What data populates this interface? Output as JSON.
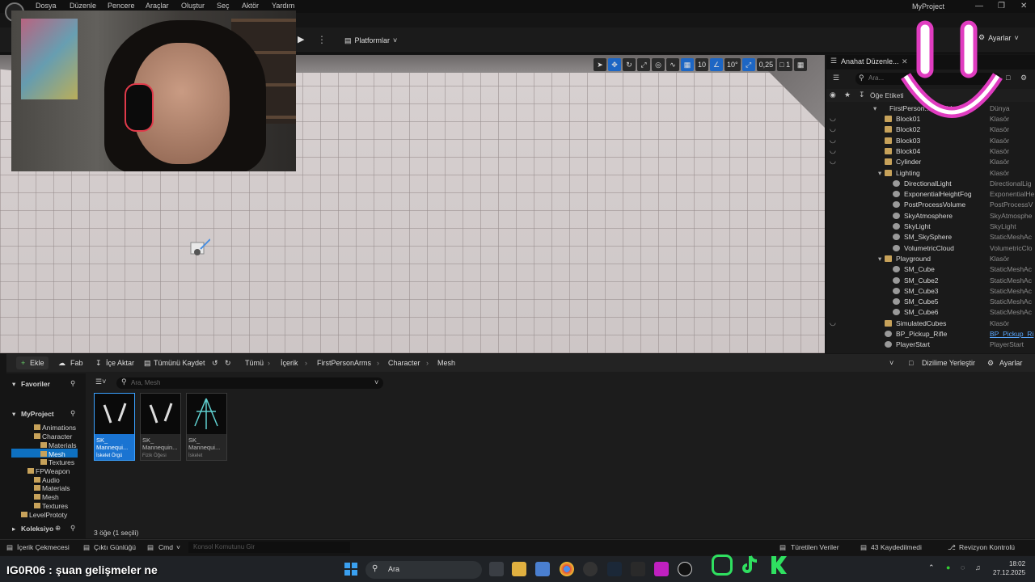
{
  "menu": {
    "items": [
      "Dosya",
      "Düzenle",
      "Pencere",
      "Araçlar",
      "Oluştur",
      "Seç",
      "Aktör",
      "Yardım"
    ]
  },
  "app": {
    "project": "MyProject"
  },
  "toolbar": {
    "platforms": "Platformlar",
    "settings": "Ayarlar"
  },
  "viewport_tools": {
    "grid": "10",
    "angle": "10°",
    "scale": "0,25",
    "cams": "1"
  },
  "outliner": {
    "title": "Anahat Düzenle...",
    "search_placeholder": "Ara...",
    "col_label": "Öğe Etiketi",
    "root": {
      "name": "FirstPerson...(Editör)",
      "type": "Dünya"
    },
    "rows": [
      {
        "name": "Block01",
        "type": "Klasör"
      },
      {
        "name": "Block02",
        "type": "Klasör"
      },
      {
        "name": "Block03",
        "type": "Klasör"
      },
      {
        "name": "Block04",
        "type": "Klasör"
      },
      {
        "name": "Cylinder",
        "type": "Klasör"
      },
      {
        "name": "Lighting",
        "type": "Klasör"
      },
      {
        "name": "DirectionalLight",
        "type": "DirectionalLig"
      },
      {
        "name": "ExponentialHeightFog",
        "type": "ExponentialHe"
      },
      {
        "name": "PostProcessVolume",
        "type": "PostProcessV"
      },
      {
        "name": "SkyAtmosphere",
        "type": "SkyAtmosphe"
      },
      {
        "name": "SkyLight",
        "type": "SkyLight"
      },
      {
        "name": "SM_SkySphere",
        "type": "StaticMeshAc"
      },
      {
        "name": "VolumetricCloud",
        "type": "VolumetricClo"
      },
      {
        "name": "Playground",
        "type": "Klasör"
      },
      {
        "name": "SM_Cube",
        "type": "StaticMeshAc"
      },
      {
        "name": "SM_Cube2",
        "type": "StaticMeshAc"
      },
      {
        "name": "SM_Cube3",
        "type": "StaticMeshAc"
      },
      {
        "name": "SM_Cube5",
        "type": "StaticMeshAc"
      },
      {
        "name": "SM_Cube6",
        "type": "StaticMeshAc"
      },
      {
        "name": "SimulatedCubes",
        "type": "Klasör"
      },
      {
        "name": "BP_Pickup_Rifle",
        "type": "BP_Pickup_Ri"
      },
      {
        "name": "PlayerStart",
        "type": "PlayerStart"
      }
    ]
  },
  "content_browser": {
    "add": "Ekle",
    "fab": "Fab",
    "import": "İçe Aktar",
    "save_all": "Tümünü Kaydet",
    "breadcrumb": [
      "Tümü",
      "İçerik",
      "FirstPersonArms",
      "Character",
      "Mesh"
    ],
    "dock": "Dizilime Yerleştir",
    "settings": "Ayarlar",
    "favorites": "Favoriler",
    "project": "MyProject",
    "collections": "Koleksiyo",
    "search_placeholder": "Ara, Mesh",
    "tree": [
      "Animations",
      "Character",
      "Materials",
      "Mesh",
      "Textures",
      "FPWeapon",
      "Audio",
      "Materials",
      "Mesh",
      "Textures",
      "LevelPrototy"
    ],
    "assets": [
      {
        "name": "SK_ Mannequi...",
        "type": "İskelet Örgü"
      },
      {
        "name": "SK_ Mannequin...",
        "type": "Fizik Öğesi"
      },
      {
        "name": "SK_ Mannequi...",
        "type": "İskelet"
      }
    ],
    "count": "3 öğe (1 seçili)"
  },
  "status": {
    "drawer": "İçerik Çekmecesi",
    "log": "Çıktı Günlüğü",
    "cmd": "Cmd",
    "console_placeholder": "Konsol Komutunu Gir",
    "derived": "Türetilen Veriler",
    "unsaved": "43 Kaydedilmedi",
    "revision": "Revizyon Kontrolü"
  },
  "taskbar": {
    "search": "Ara",
    "time": "18:02",
    "date": "27.12.2025"
  },
  "overlay": {
    "caption": "IG0R06 : şuan gelişmeler ne"
  }
}
